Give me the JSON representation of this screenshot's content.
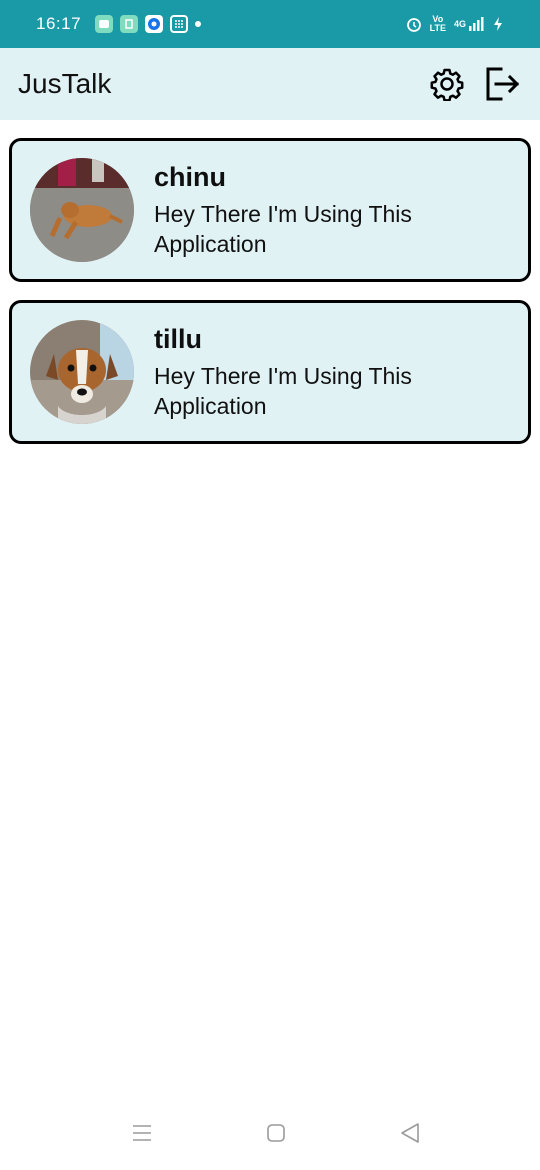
{
  "status_bar": {
    "time": "16:17",
    "network": "4G",
    "volte_top": "Vo",
    "volte_bottom": "LTE"
  },
  "app_bar": {
    "title": "JusTalk",
    "settings_icon": "gear-icon",
    "logout_icon": "logout-icon"
  },
  "chats": [
    {
      "name": "chinu",
      "status": "Hey There I'm Using This Application",
      "avatar": "dog-photo"
    },
    {
      "name": "tillu",
      "status": "Hey There I'm Using This Application",
      "avatar": "puppy-photo"
    }
  ],
  "nav_bar": {
    "icons": [
      "menu-icon",
      "home-icon",
      "back-icon"
    ]
  },
  "colors": {
    "status_bar": "#1a9aa6",
    "app_bar": "#e1f2f5",
    "card_bg": "#e1f2f5",
    "card_border": "#000000"
  }
}
